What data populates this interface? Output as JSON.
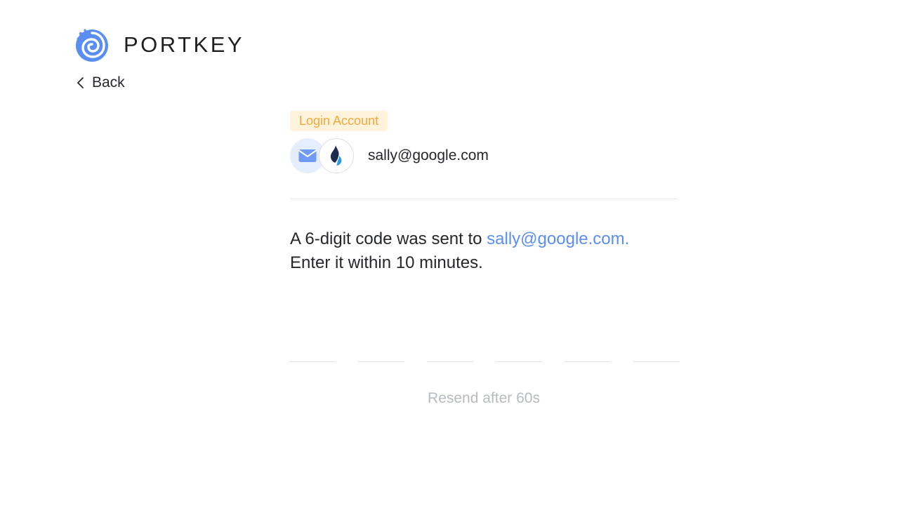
{
  "brand": {
    "name": "PORTKEY",
    "logo_icon": "portkey-swirl-icon",
    "color": "#5b8ef4"
  },
  "nav": {
    "back_label": "Back",
    "back_icon": "chevron-left-icon"
  },
  "account": {
    "tag_label": "Login Account",
    "email": "sally@google.com",
    "type_icon": "mail-icon",
    "chain_icon": "huobi-flame-icon"
  },
  "verification": {
    "message_prefix": "A 6-digit code was sent to ",
    "message_email": "sally@google.com.",
    "message_suffix": "Enter it within 10 minutes.",
    "code_length": 6,
    "code_values": [
      "",
      "",
      "",
      "",
      "",
      ""
    ],
    "resend_label": "Resend after 60s"
  },
  "colors": {
    "accent": "#5b8ef4",
    "tag_text": "#f3a73b",
    "tag_background": "#fff3dc",
    "muted_text": "#b7bac1"
  }
}
